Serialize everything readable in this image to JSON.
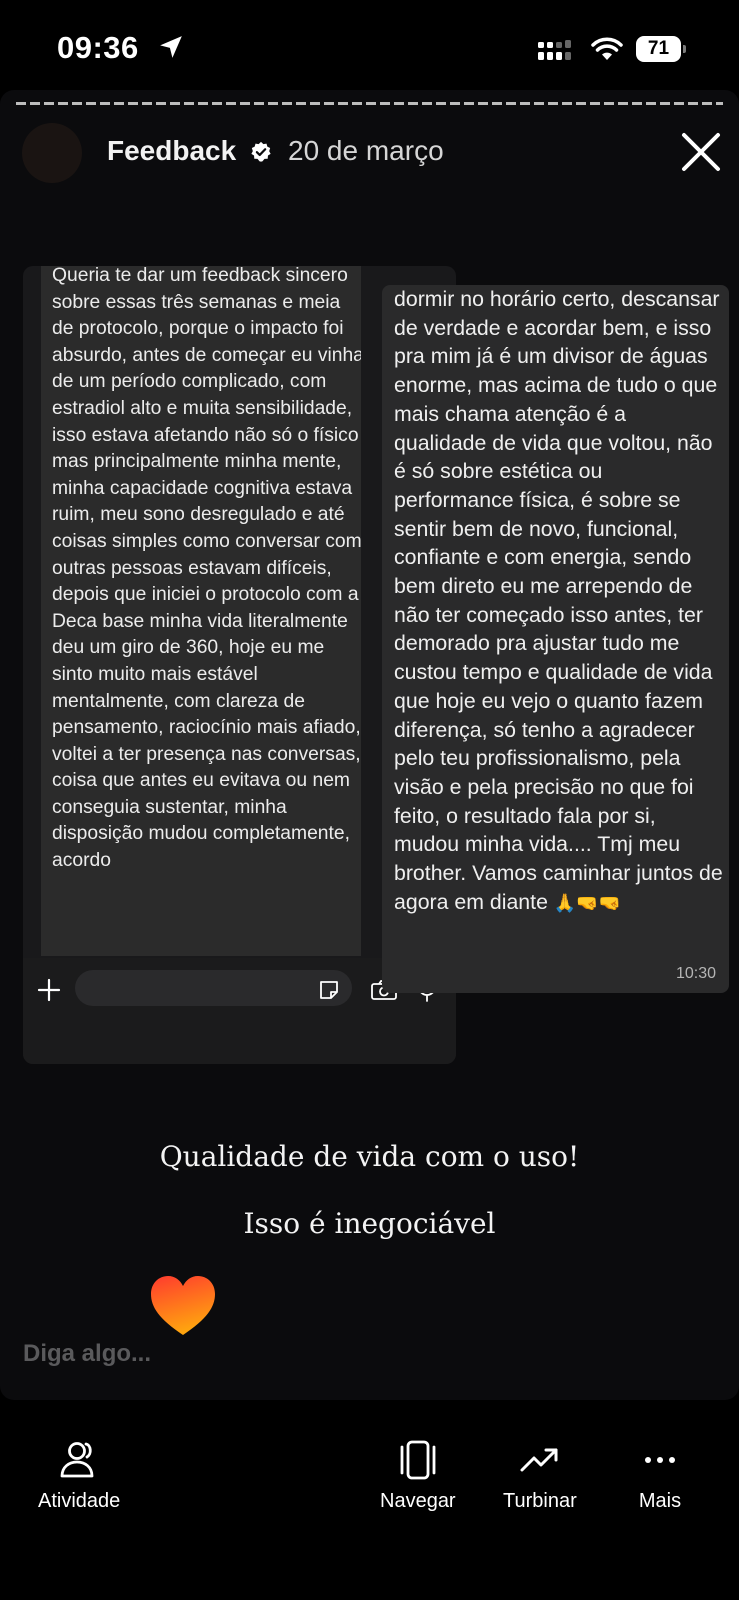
{
  "status_bar": {
    "time": "09:36",
    "battery": "71"
  },
  "story": {
    "author": "Feedback",
    "date": "20 de março",
    "left_message": "Queria te dar um feedback sincero sobre essas três semanas e meia de protocolo, porque o impacto foi absurdo, antes de começar eu vinha de um período complicado, com estradiol alto e muita sensibilidade, isso estava afetando não só o físico mas principalmente minha mente, minha capacidade cognitiva estava ruim, meu sono desregulado e até coisas simples como conversar com outras pessoas estavam difíceis, depois que iniciei o protocolo com a Deca base minha vida literalmente deu um giro de 360, hoje eu me sinto muito mais estável mentalmente, com clareza de pensamento, raciocínio mais afiado, voltei a ter presença nas conversas, coisa que antes eu evitava ou nem conseguia sustentar, minha disposição mudou completamente, acordo",
    "right_message": "dormir no horário certo, descansar de verdade e acordar bem, e isso pra mim já é um divisor de águas enorme, mas acima de tudo o que mais chama atenção é a qualidade de vida que voltou, não é só sobre estética ou performance física, é sobre se sentir bem de novo, funcional, confiante e com energia, sendo bem direto eu me arrependo de não ter começado isso antes, ter demorado pra ajustar tudo me custou tempo e qualidade de vida que hoje eu vejo o quanto fazem diferença, só tenho a agradecer pelo teu profissionalismo, pela visão e pela precisão no que foi feito, o resultado fala por si, mudou minha vida.... Tmj meu brother. Vamos caminhar juntos de agora em diante",
    "right_message_emoji": "🙏🤜🤜",
    "message_time": "10:30",
    "caption_1": "Qualidade de vida com o uso!",
    "caption_2": "Isso é inegociável",
    "reply_placeholder": "Diga algo..."
  },
  "bottom_nav": [
    {
      "label": "Atividade",
      "icon": "activity-icon"
    },
    {
      "label": "Navegar",
      "icon": "browse-icon"
    },
    {
      "label": "Turbinar",
      "icon": "boost-icon"
    },
    {
      "label": "Mais",
      "icon": "more-icon"
    }
  ],
  "colors": {
    "background": "#000000",
    "panel": "#0b0b0d",
    "bubble": "#2a2a2b",
    "heart_top": "#ff4a2a",
    "heart_bottom": "#ff9a10"
  }
}
